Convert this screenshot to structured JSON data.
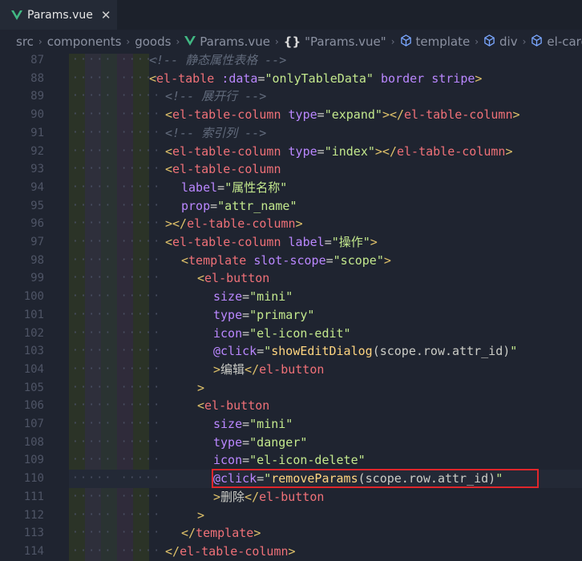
{
  "tab": {
    "filename": "Params.vue",
    "close_glyph": "✕"
  },
  "breadcrumb": [
    {
      "label": "src",
      "icon": ""
    },
    {
      "label": "components",
      "icon": ""
    },
    {
      "label": "goods",
      "icon": ""
    },
    {
      "label": "Params.vue",
      "icon": "vue-icon"
    },
    {
      "label": "\"Params.vue\"",
      "icon": "braces-icon",
      "icon_text": "{}"
    },
    {
      "label": "template",
      "icon": "cube-icon"
    },
    {
      "label": "div",
      "icon": "cube-icon"
    },
    {
      "label": "el-card",
      "icon": "cube-icon"
    }
  ],
  "breadcrumb_separator": "›",
  "colors": {
    "background": "#1f2430",
    "highlight_box": "#e0262b",
    "vue_green": "#41b883"
  },
  "lines": [
    {
      "n": "87",
      "indent": 0,
      "tokens": [
        [
          "cmt",
          "<!-- 静态属性表格 -->"
        ]
      ]
    },
    {
      "n": "88",
      "indent": 0,
      "tokens": [
        [
          "br",
          "<"
        ],
        [
          "tag",
          "el-table"
        ],
        [
          "txt",
          " "
        ],
        [
          "attr",
          ":data"
        ],
        [
          "eq",
          "="
        ],
        [
          "str",
          "\"onlyTableData\""
        ],
        [
          "txt",
          " "
        ],
        [
          "attr",
          "border"
        ],
        [
          "txt",
          " "
        ],
        [
          "attr",
          "stripe"
        ],
        [
          "br",
          ">"
        ]
      ]
    },
    {
      "n": "89",
      "indent": 1,
      "tokens": [
        [
          "cmt",
          "<!-- 展开行 -->"
        ]
      ]
    },
    {
      "n": "90",
      "indent": 1,
      "tokens": [
        [
          "br",
          "<"
        ],
        [
          "tag",
          "el-table-column"
        ],
        [
          "txt",
          " "
        ],
        [
          "attr",
          "type"
        ],
        [
          "eq",
          "="
        ],
        [
          "str",
          "\"expand\""
        ],
        [
          "br",
          "></"
        ],
        [
          "tag",
          "el-table-column"
        ],
        [
          "br",
          ">"
        ]
      ]
    },
    {
      "n": "91",
      "indent": 1,
      "tokens": [
        [
          "cmt",
          "<!-- 索引列 -->"
        ]
      ]
    },
    {
      "n": "92",
      "indent": 1,
      "tokens": [
        [
          "br",
          "<"
        ],
        [
          "tag",
          "el-table-column"
        ],
        [
          "txt",
          " "
        ],
        [
          "attr",
          "type"
        ],
        [
          "eq",
          "="
        ],
        [
          "str",
          "\"index\""
        ],
        [
          "br",
          "></"
        ],
        [
          "tag",
          "el-table-column"
        ],
        [
          "br",
          ">"
        ]
      ]
    },
    {
      "n": "93",
      "indent": 1,
      "tokens": [
        [
          "br",
          "<"
        ],
        [
          "tag",
          "el-table-column"
        ]
      ]
    },
    {
      "n": "94",
      "indent": 2,
      "tokens": [
        [
          "attr",
          "label"
        ],
        [
          "eq",
          "="
        ],
        [
          "str",
          "\"属性名称\""
        ]
      ]
    },
    {
      "n": "95",
      "indent": 2,
      "tokens": [
        [
          "attr",
          "prop"
        ],
        [
          "eq",
          "="
        ],
        [
          "str",
          "\"attr_name\""
        ]
      ]
    },
    {
      "n": "96",
      "indent": 1,
      "tokens": [
        [
          "br",
          "></"
        ],
        [
          "tag",
          "el-table-column"
        ],
        [
          "br",
          ">"
        ]
      ]
    },
    {
      "n": "97",
      "indent": 1,
      "tokens": [
        [
          "br",
          "<"
        ],
        [
          "tag",
          "el-table-column"
        ],
        [
          "txt",
          " "
        ],
        [
          "attr",
          "label"
        ],
        [
          "eq",
          "="
        ],
        [
          "str",
          "\"操作\""
        ],
        [
          "br",
          ">"
        ]
      ]
    },
    {
      "n": "98",
      "indent": 2,
      "tokens": [
        [
          "br",
          "<"
        ],
        [
          "tag",
          "template"
        ],
        [
          "txt",
          " "
        ],
        [
          "attr",
          "slot-scope"
        ],
        [
          "eq",
          "="
        ],
        [
          "str",
          "\"scope\""
        ],
        [
          "br",
          ">"
        ]
      ]
    },
    {
      "n": "99",
      "indent": 3,
      "tokens": [
        [
          "br",
          "<"
        ],
        [
          "tag",
          "el-button"
        ]
      ]
    },
    {
      "n": "100",
      "indent": 4,
      "tokens": [
        [
          "attr",
          "size"
        ],
        [
          "eq",
          "="
        ],
        [
          "str",
          "\"mini\""
        ]
      ]
    },
    {
      "n": "101",
      "indent": 4,
      "tokens": [
        [
          "attr",
          "type"
        ],
        [
          "eq",
          "="
        ],
        [
          "str",
          "\"primary\""
        ]
      ]
    },
    {
      "n": "102",
      "indent": 4,
      "tokens": [
        [
          "attr",
          "icon"
        ],
        [
          "eq",
          "="
        ],
        [
          "str",
          "\"el-icon-edit\""
        ]
      ]
    },
    {
      "n": "103",
      "indent": 4,
      "tokens": [
        [
          "attr",
          "@click"
        ],
        [
          "eq",
          "="
        ],
        [
          "str",
          "\""
        ],
        [
          "fn",
          "showEditDialog"
        ],
        [
          "txt",
          "(scope.row.attr_id)"
        ],
        [
          "str",
          "\""
        ]
      ]
    },
    {
      "n": "104",
      "indent": 4,
      "tokens": [
        [
          "br",
          ">"
        ],
        [
          "txt",
          "编辑"
        ],
        [
          "br",
          "</"
        ],
        [
          "tag",
          "el-button"
        ]
      ]
    },
    {
      "n": "105",
      "indent": 3,
      "tokens": [
        [
          "br",
          ">"
        ]
      ]
    },
    {
      "n": "106",
      "indent": 3,
      "tokens": [
        [
          "br",
          "<"
        ],
        [
          "tag",
          "el-button"
        ]
      ]
    },
    {
      "n": "107",
      "indent": 4,
      "tokens": [
        [
          "attr",
          "size"
        ],
        [
          "eq",
          "="
        ],
        [
          "str",
          "\"mini\""
        ]
      ]
    },
    {
      "n": "108",
      "indent": 4,
      "tokens": [
        [
          "attr",
          "type"
        ],
        [
          "eq",
          "="
        ],
        [
          "str",
          "\"danger\""
        ]
      ]
    },
    {
      "n": "109",
      "indent": 4,
      "tokens": [
        [
          "attr",
          "icon"
        ],
        [
          "eq",
          "="
        ],
        [
          "str",
          "\"el-icon-delete\""
        ]
      ]
    },
    {
      "n": "110",
      "indent": 4,
      "tokens": [
        [
          "attr",
          "@click"
        ],
        [
          "eq",
          "="
        ],
        [
          "str",
          "\""
        ],
        [
          "fn",
          "removeParams"
        ],
        [
          "txt",
          "(scope.row.attr_id)"
        ],
        [
          "str",
          "\""
        ]
      ]
    },
    {
      "n": "111",
      "indent": 4,
      "tokens": [
        [
          "br",
          ">"
        ],
        [
          "txt",
          "删除"
        ],
        [
          "br",
          "</"
        ],
        [
          "tag",
          "el-button"
        ]
      ]
    },
    {
      "n": "112",
      "indent": 3,
      "tokens": [
        [
          "br",
          ">"
        ]
      ]
    },
    {
      "n": "113",
      "indent": 2,
      "tokens": [
        [
          "br",
          "</"
        ],
        [
          "tag",
          "template"
        ],
        [
          "br",
          ">"
        ]
      ]
    },
    {
      "n": "114",
      "indent": 1,
      "tokens": [
        [
          "br",
          "</"
        ],
        [
          "tag",
          "el-table-column"
        ],
        [
          "br",
          ">"
        ]
      ]
    }
  ],
  "highlighted_line": "110",
  "current_line": "110"
}
